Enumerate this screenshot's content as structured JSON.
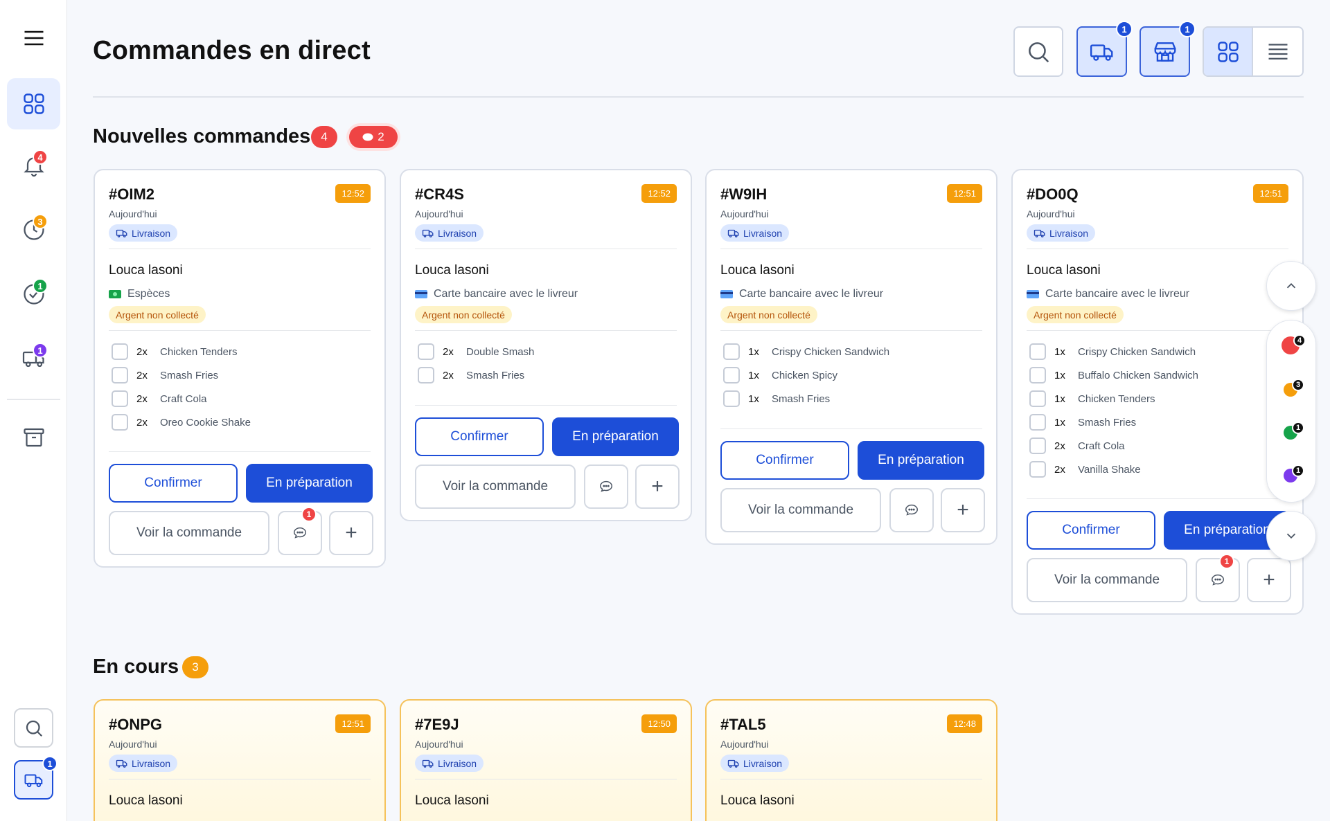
{
  "colors": {
    "accent": "#1d4ed8",
    "red": "#ef4444",
    "orange": "#f59e0b",
    "green": "#16a34a",
    "purple": "#7c3aed"
  },
  "sidebar": {
    "badges": {
      "notifications": "4",
      "history": "3",
      "completed": "1",
      "delivery": "1",
      "bottom_delivery": "1"
    }
  },
  "header": {
    "title": "Commandes en direct",
    "delivery_badge": "1",
    "store_badge": "1"
  },
  "sections": {
    "new": {
      "title": "Nouvelles commandes",
      "count": "4",
      "messages": "2"
    },
    "ongoing": {
      "title": "En cours",
      "count": "3"
    }
  },
  "labels": {
    "today": "Aujourd'hui",
    "delivery": "Livraison",
    "uncollected": "Argent non collecté",
    "confirm": "Confirmer",
    "prep": "En préparation",
    "view": "Voir la commande",
    "plus": "+"
  },
  "new_orders": [
    {
      "code": "#OIM2",
      "time": "12:52",
      "customer": "Louca lasoni",
      "payment": "Espèces",
      "items": [
        {
          "qty": "2x",
          "name": "Chicken Tenders"
        },
        {
          "qty": "2x",
          "name": "Smash Fries"
        },
        {
          "qty": "2x",
          "name": "Craft Cola"
        },
        {
          "qty": "2x",
          "name": "Oreo Cookie Shake"
        }
      ],
      "chat_badge": "1"
    },
    {
      "code": "#CR4S",
      "time": "12:52",
      "customer": "Louca lasoni",
      "payment": "Carte bancaire avec le livreur",
      "items": [
        {
          "qty": "2x",
          "name": "Double Smash"
        },
        {
          "qty": "2x",
          "name": "Smash Fries"
        }
      ],
      "chat_badge": ""
    },
    {
      "code": "#W9IH",
      "time": "12:51",
      "customer": "Louca lasoni",
      "payment": "Carte bancaire avec le livreur",
      "items": [
        {
          "qty": "1x",
          "name": "Crispy Chicken Sandwich"
        },
        {
          "qty": "1x",
          "name": "Chicken Spicy"
        },
        {
          "qty": "1x",
          "name": "Smash Fries"
        }
      ],
      "chat_badge": ""
    },
    {
      "code": "#DO0Q",
      "time": "12:51",
      "customer": "Louca lasoni",
      "payment": "Carte bancaire avec le livreur",
      "items": [
        {
          "qty": "1x",
          "name": "Crispy Chicken Sandwich"
        },
        {
          "qty": "1x",
          "name": "Buffalo Chicken Sandwich"
        },
        {
          "qty": "1x",
          "name": "Chicken Tenders"
        },
        {
          "qty": "1x",
          "name": "Smash Fries"
        },
        {
          "qty": "2x",
          "name": "Craft Cola"
        },
        {
          "qty": "2x",
          "name": "Vanilla Shake"
        }
      ],
      "chat_badge": "1"
    }
  ],
  "ongoing_orders": [
    {
      "code": "#ONPG",
      "time": "12:51",
      "customer": "Louca lasoni"
    },
    {
      "code": "#7E9J",
      "time": "12:50",
      "customer": "Louca lasoni"
    },
    {
      "code": "#TAL5",
      "time": "12:48",
      "customer": "Louca lasoni"
    }
  ],
  "scroll_nav": {
    "dots": [
      {
        "color": "#ef4444",
        "badge": "4"
      },
      {
        "color": "#f59e0b",
        "badge": "3"
      },
      {
        "color": "#16a34a",
        "badge": "1"
      },
      {
        "color": "#7c3aed",
        "badge": "1"
      }
    ]
  }
}
